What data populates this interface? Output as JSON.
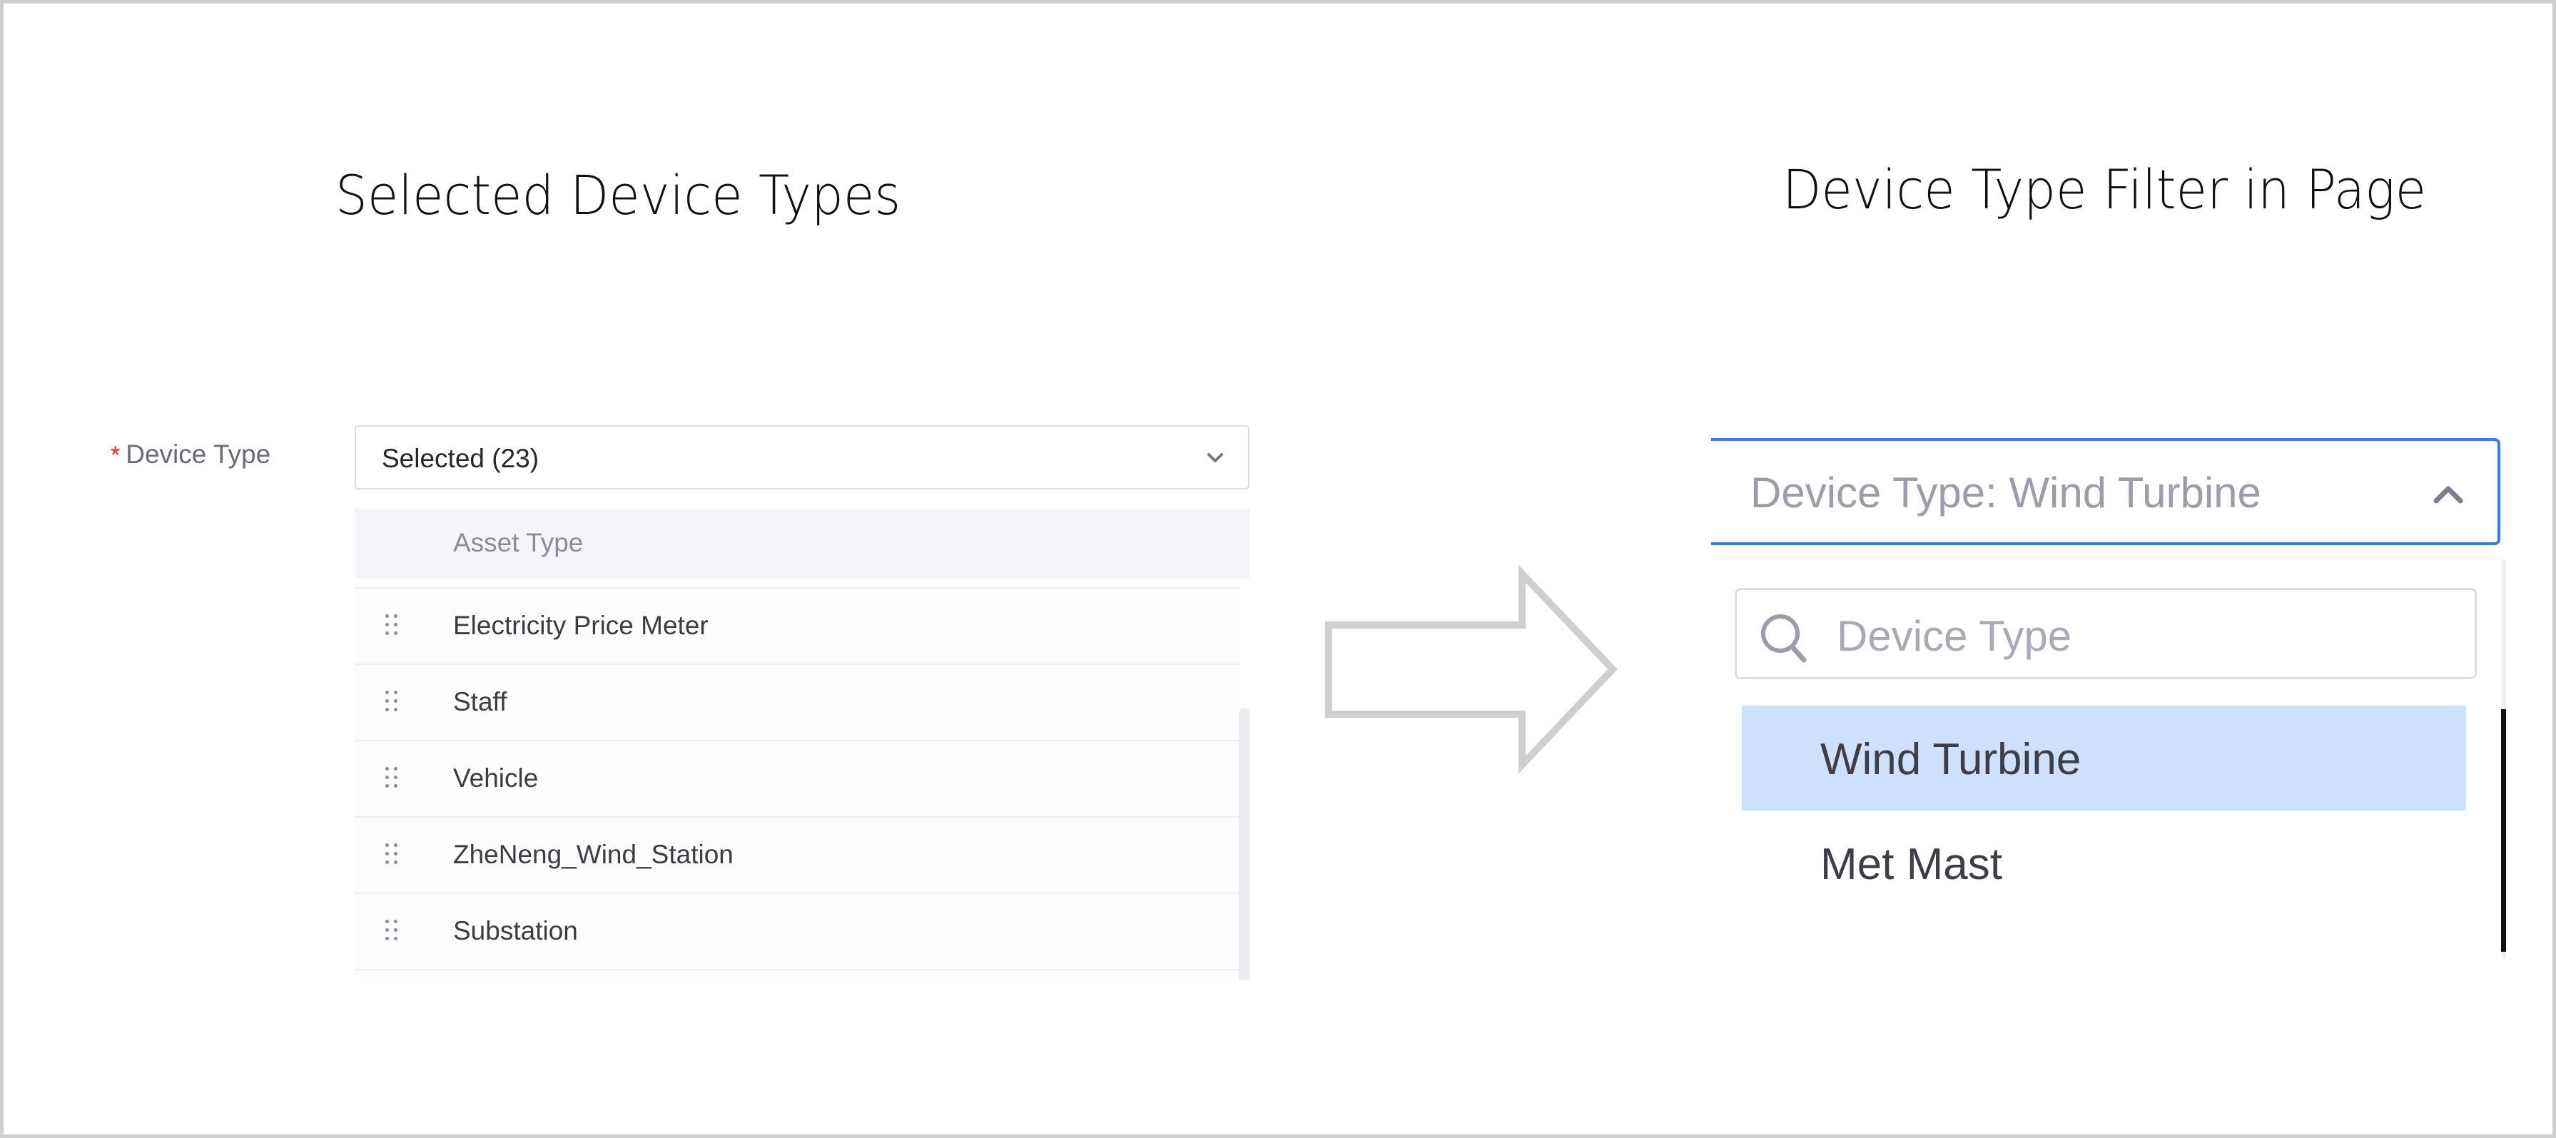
{
  "titles": {
    "left": "Selected Device Types",
    "right": "Device Type Filter in Page"
  },
  "form": {
    "required_marker": "*",
    "label": "Device Type",
    "select_value": "Selected (23)",
    "select_icon": "chevron-down-icon",
    "list_header": "Asset Type",
    "items": [
      {
        "label": "Electricity Price Meter",
        "icon": "drag-handle-icon"
      },
      {
        "label": "Staff",
        "icon": "drag-handle-icon"
      },
      {
        "label": "Vehicle",
        "icon": "drag-handle-icon"
      },
      {
        "label": "ZheNeng_Wind_Station",
        "icon": "drag-handle-icon"
      },
      {
        "label": "Substation",
        "icon": "drag-handle-icon"
      }
    ]
  },
  "arrow": {
    "icon": "right-arrow-icon",
    "color": "#d0cfd0"
  },
  "filter": {
    "value": "Device Type: Wind Turbine",
    "toggle_icon": "chevron-up-icon",
    "accent_color": "#2f7df6",
    "search": {
      "icon": "search-icon",
      "placeholder": "Device Type"
    },
    "options": [
      {
        "label": "Wind Turbine",
        "selected": true
      },
      {
        "label": "Met Mast",
        "selected": false
      }
    ],
    "selected_bg": "#cde0fc"
  }
}
